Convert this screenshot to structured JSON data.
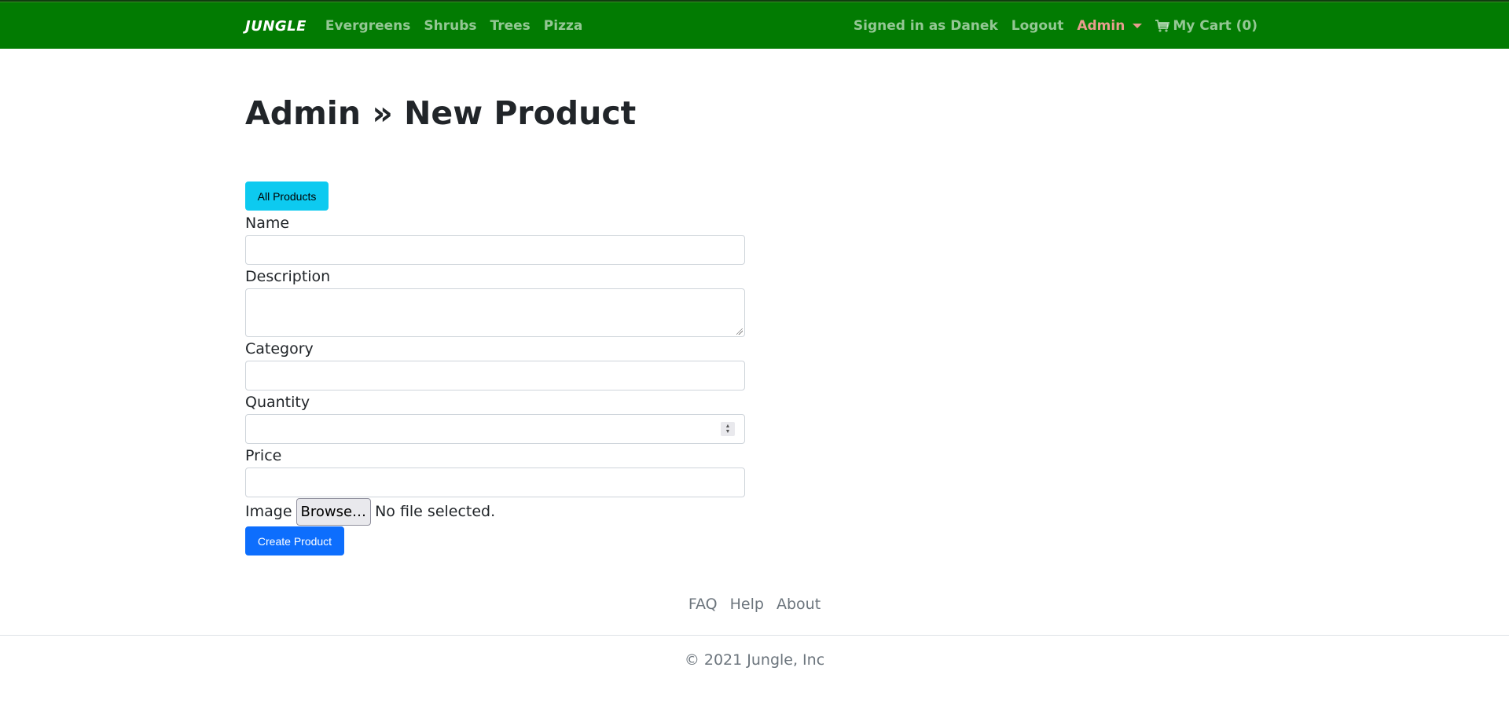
{
  "navbar": {
    "brand": "JUNGLE",
    "links": [
      "Evergreens",
      "Shrubs",
      "Trees",
      "Pizza"
    ],
    "signed_in": "Signed in as Danek",
    "logout": "Logout",
    "admin": "Admin",
    "cart": "My Cart (0)",
    "bg_color": "#027b02"
  },
  "page": {
    "title": "Admin » New Product",
    "all_products_button": "All Products"
  },
  "form": {
    "name_label": "Name",
    "name_value": "",
    "description_label": "Description",
    "description_value": "",
    "category_label": "Category",
    "category_value": "",
    "quantity_label": "Quantity",
    "quantity_value": "",
    "price_label": "Price",
    "price_value": "",
    "image_label": "Image",
    "browse_label": "Browse…",
    "no_file": "No file selected.",
    "submit": "Create Product"
  },
  "footer": {
    "links": [
      "FAQ",
      "Help",
      "About"
    ],
    "copyright": "© 2021 Jungle, Inc"
  }
}
